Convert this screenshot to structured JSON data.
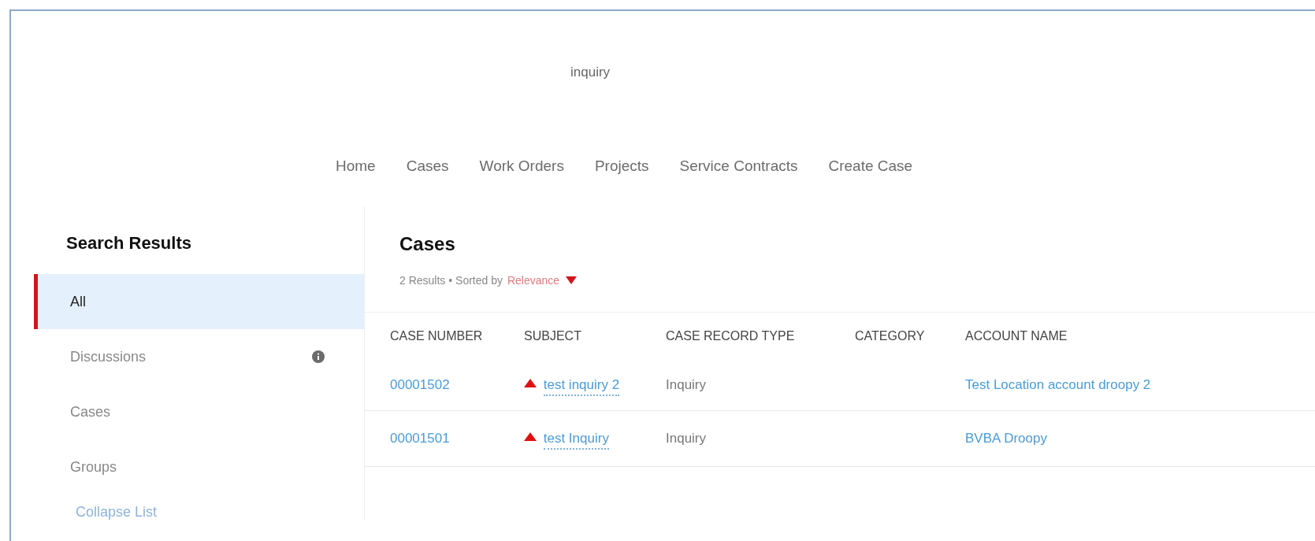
{
  "search_term": "inquiry",
  "nav": [
    {
      "label": "Home"
    },
    {
      "label": "Cases"
    },
    {
      "label": "Work Orders"
    },
    {
      "label": "Projects"
    },
    {
      "label": "Service Contracts"
    },
    {
      "label": "Create Case"
    }
  ],
  "sidebar": {
    "title": "Search Results",
    "items": [
      {
        "label": "All",
        "selected": true,
        "info": false
      },
      {
        "label": "Discussions",
        "selected": false,
        "info": true
      },
      {
        "label": "Cases",
        "selected": false,
        "info": false
      },
      {
        "label": "Groups",
        "selected": false,
        "info": false
      }
    ],
    "collapse_link": "Collapse List"
  },
  "results": {
    "title": "Cases",
    "summary": "2 Results • Sorted by",
    "sort": "Relevance",
    "columns": [
      "CASE NUMBER",
      "SUBJECT",
      "CASE RECORD TYPE",
      "CATEGORY",
      "ACCOUNT NAME"
    ],
    "rows": [
      {
        "case_number": "00001502",
        "subject": "test inquiry 2",
        "escalated": true,
        "record_type": "Inquiry",
        "account": "Test Location account droopy 2"
      },
      {
        "case_number": "00001501",
        "subject": "test Inquiry",
        "escalated": true,
        "record_type": "Inquiry",
        "account": "BVBA Droopy"
      }
    ]
  }
}
